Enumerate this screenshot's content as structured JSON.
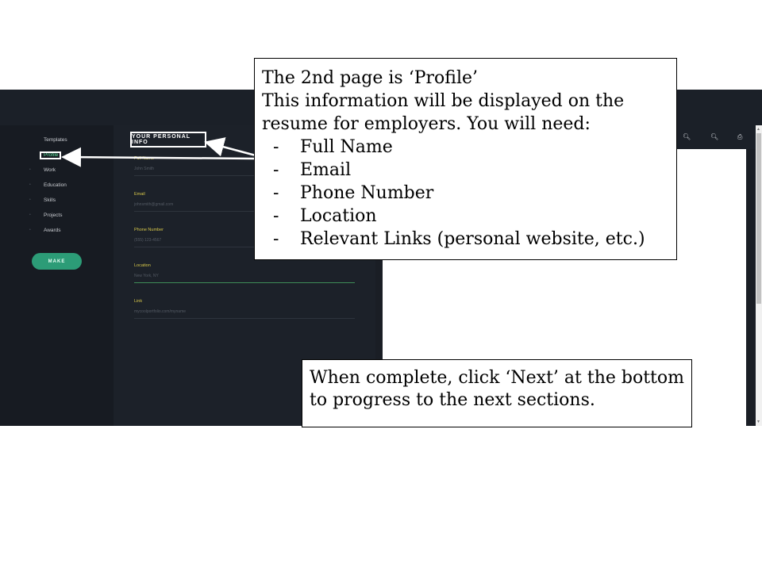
{
  "sidebar": {
    "items": [
      {
        "label": "Templates"
      },
      {
        "label": "Profile"
      },
      {
        "label": "Work"
      },
      {
        "label": "Education"
      },
      {
        "label": "Skills"
      },
      {
        "label": "Projects"
      },
      {
        "label": "Awards"
      }
    ],
    "make_label": "MAKE"
  },
  "form": {
    "section_title": "YOUR PERSONAL INFO",
    "fields": [
      {
        "label": "Full Name",
        "value": "John Smith"
      },
      {
        "label": "Email",
        "value": "johnsmith@gmail.com"
      },
      {
        "label": "Phone Number",
        "value": "(555) 123-4567"
      },
      {
        "label": "Location",
        "value": "New York, NY"
      },
      {
        "label": "Link",
        "value": "mycoolportfolio.com/myname"
      }
    ]
  },
  "toolbar": {
    "icons": [
      "zoom-out-icon",
      "zoom-in-icon",
      "print-icon"
    ]
  },
  "callouts": {
    "profile": {
      "line1": "The 2nd page is ‘Profile’",
      "line2": "This information will be displayed on the resume for employers. You will need:",
      "items": [
        "Full Name",
        "Email",
        "Phone Number",
        "Location",
        "Relevant Links (personal website, etc.)"
      ]
    },
    "next": {
      "text": "When complete, click ‘Next’ at the bottom to progress to the next sections."
    }
  },
  "colors": {
    "app_bg": "#1a1e25",
    "accent": "#2c9c77",
    "active_text": "#5fe39b",
    "label": "#d8c84a"
  }
}
